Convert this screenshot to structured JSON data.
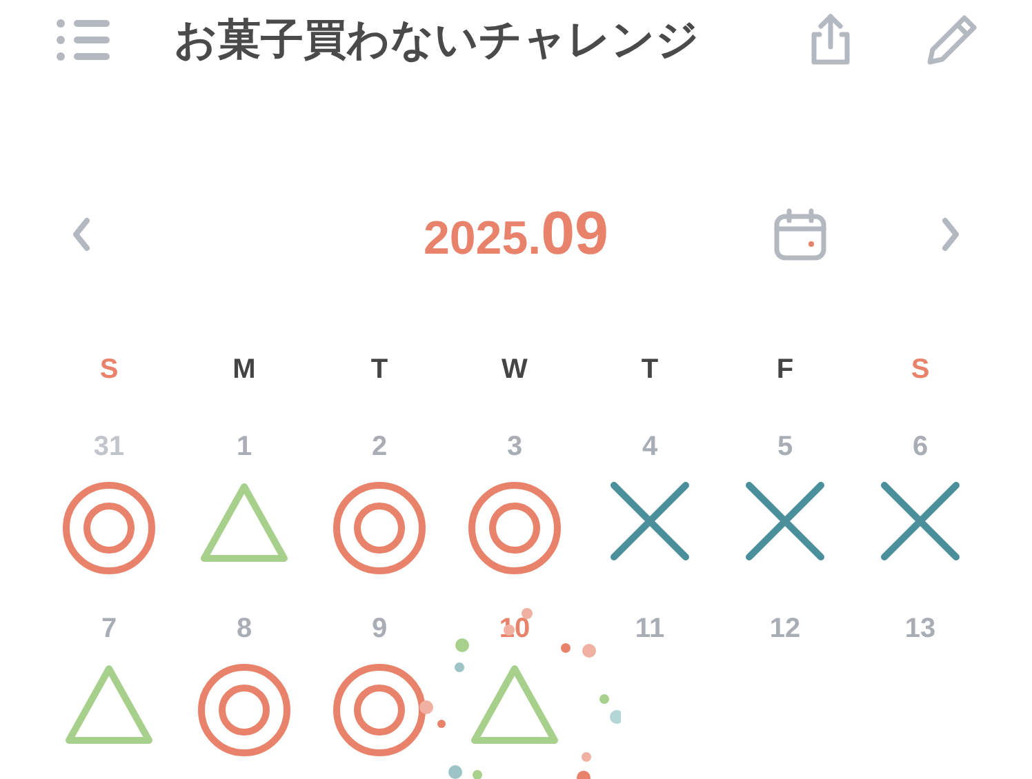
{
  "header": {
    "title": "お菓子買わないチャレンジ"
  },
  "month_nav": {
    "year": "2025.",
    "month": "09"
  },
  "weekdays": [
    {
      "label": "S",
      "weekend": true
    },
    {
      "label": "M",
      "weekend": false
    },
    {
      "label": "T",
      "weekend": false
    },
    {
      "label": "W",
      "weekend": false
    },
    {
      "label": "T",
      "weekend": false
    },
    {
      "label": "F",
      "weekend": false
    },
    {
      "label": "S",
      "weekend": true
    }
  ],
  "weeks": [
    [
      {
        "date": "31",
        "outside": true,
        "today": false,
        "kind": "double-circle"
      },
      {
        "date": "1",
        "outside": false,
        "today": false,
        "kind": "triangle"
      },
      {
        "date": "2",
        "outside": false,
        "today": false,
        "kind": "double-circle"
      },
      {
        "date": "3",
        "outside": false,
        "today": false,
        "kind": "double-circle"
      },
      {
        "date": "4",
        "outside": false,
        "today": false,
        "kind": "cross"
      },
      {
        "date": "5",
        "outside": false,
        "today": false,
        "kind": "cross"
      },
      {
        "date": "6",
        "outside": false,
        "today": false,
        "kind": "cross"
      }
    ],
    [
      {
        "date": "7",
        "outside": false,
        "today": false,
        "kind": "triangle"
      },
      {
        "date": "8",
        "outside": false,
        "today": false,
        "kind": "double-circle"
      },
      {
        "date": "9",
        "outside": false,
        "today": false,
        "kind": "double-circle"
      },
      {
        "date": "10",
        "outside": false,
        "today": true,
        "kind": "triangle"
      },
      {
        "date": "11",
        "outside": false,
        "today": false,
        "kind": "empty"
      },
      {
        "date": "12",
        "outside": false,
        "today": false,
        "kind": "empty"
      },
      {
        "date": "13",
        "outside": false,
        "today": false,
        "kind": "empty"
      }
    ]
  ]
}
